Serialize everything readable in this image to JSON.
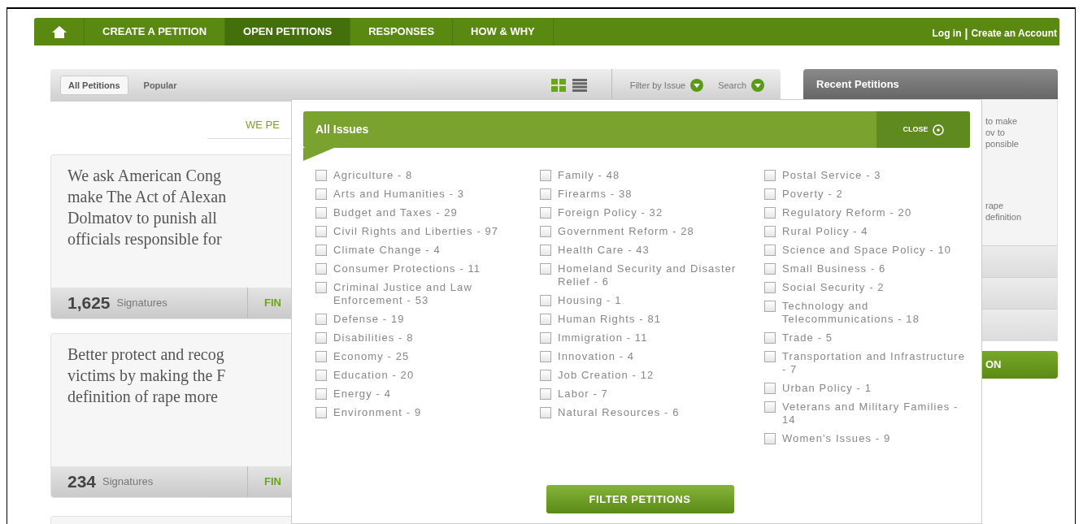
{
  "nav": {
    "items": [
      {
        "kind": "home",
        "selected": false
      },
      {
        "kind": "link",
        "label": "CREATE A PETITION",
        "selected": false
      },
      {
        "kind": "link",
        "label": "OPEN PETITIONS",
        "selected": true
      },
      {
        "kind": "link",
        "label": "RESPONSES",
        "selected": false
      },
      {
        "kind": "link",
        "label": "HOW & WHY",
        "selected": false
      }
    ],
    "account_links": [
      "Log in",
      "Create an Account"
    ],
    "separator": "|"
  },
  "toolbar": {
    "tabs": [
      {
        "label": "All Petitions",
        "selected": true
      },
      {
        "label": "Popular",
        "selected": false
      }
    ],
    "view_toggles": [
      {
        "kind": "grid",
        "selected": true
      },
      {
        "kind": "list",
        "selected": false
      }
    ],
    "dropdowns": [
      "Filter by Issue",
      "Search"
    ]
  },
  "heading": "WE PE",
  "petitions": [
    {
      "lines": [
        "We ask American Cong",
        "make The Act of Alexan",
        "Dolmatov to punish all",
        "officials responsible for"
      ],
      "count": "1,625",
      "count_label": "Signatures",
      "action": "FIN"
    },
    {
      "lines": [
        "Better protect and recog",
        "victims by making the F",
        "definition of rape more"
      ],
      "count": "234",
      "count_label": "Signatures",
      "action": "FIN"
    }
  ],
  "sidebar": {
    "title": "Recent Petitions",
    "excerpts": [
      [
        "to make",
        "ov to",
        "ponsible"
      ],
      [
        "rape",
        "definition"
      ]
    ],
    "button": "ON"
  },
  "popup": {
    "title": "All Issues",
    "close": "CLOSE",
    "columns": [
      [
        {
          "label": "Agriculture - 8",
          "checked": false
        },
        {
          "label": "Arts and Humanities - 3",
          "checked": false
        },
        {
          "label": "Budget and Taxes - 29",
          "checked": false
        },
        {
          "label": "Civil Rights and Liberties - 97",
          "checked": false
        },
        {
          "label": "Climate Change - 4",
          "checked": false
        },
        {
          "label": "Consumer Protections - 11",
          "checked": false
        },
        {
          "label": "Criminal Justice and Law Enforcement - 53",
          "checked": false
        },
        {
          "label": "Defense - 19",
          "checked": false
        },
        {
          "label": "Disabilities - 8",
          "checked": false
        },
        {
          "label": "Economy - 25",
          "checked": false
        },
        {
          "label": "Education - 20",
          "checked": false
        },
        {
          "label": "Energy - 4",
          "checked": false
        },
        {
          "label": "Environment - 9",
          "checked": false
        }
      ],
      [
        {
          "label": "Family - 48",
          "checked": false
        },
        {
          "label": "Firearms - 38",
          "checked": false
        },
        {
          "label": "Foreign Policy - 32",
          "checked": false
        },
        {
          "label": "Government Reform - 28",
          "checked": false
        },
        {
          "label": "Health Care - 43",
          "checked": false
        },
        {
          "label": "Homeland Security and Disaster Relief - 6",
          "checked": false
        },
        {
          "label": "Housing - 1",
          "checked": false
        },
        {
          "label": "Human Rights - 81",
          "checked": false
        },
        {
          "label": "Immigration - 11",
          "checked": false
        },
        {
          "label": "Innovation - 4",
          "checked": false
        },
        {
          "label": "Job Creation - 12",
          "checked": false
        },
        {
          "label": "Labor - 7",
          "checked": false
        },
        {
          "label": "Natural Resources - 6",
          "checked": false
        }
      ],
      [
        {
          "label": "Postal Service - 3",
          "checked": false
        },
        {
          "label": "Poverty - 2",
          "checked": false
        },
        {
          "label": "Regulatory Reform - 20",
          "checked": false
        },
        {
          "label": "Rural Policy - 4",
          "checked": false
        },
        {
          "label": "Science and Space Policy - 10",
          "checked": false
        },
        {
          "label": "Small Business - 6",
          "checked": false
        },
        {
          "label": "Social Security - 2",
          "checked": false
        },
        {
          "label": "Technology and Telecommunications - 18",
          "checked": false
        },
        {
          "label": "Trade - 5",
          "checked": false
        },
        {
          "label": "Transportation and Infrastructure - 7",
          "checked": false
        },
        {
          "label": "Urban Policy - 1",
          "checked": false
        },
        {
          "label": "Veterans and Military Families - 14",
          "checked": false
        },
        {
          "label": "Women's Issues - 9",
          "checked": false
        }
      ]
    ],
    "button": "FILTER PETITIONS"
  }
}
